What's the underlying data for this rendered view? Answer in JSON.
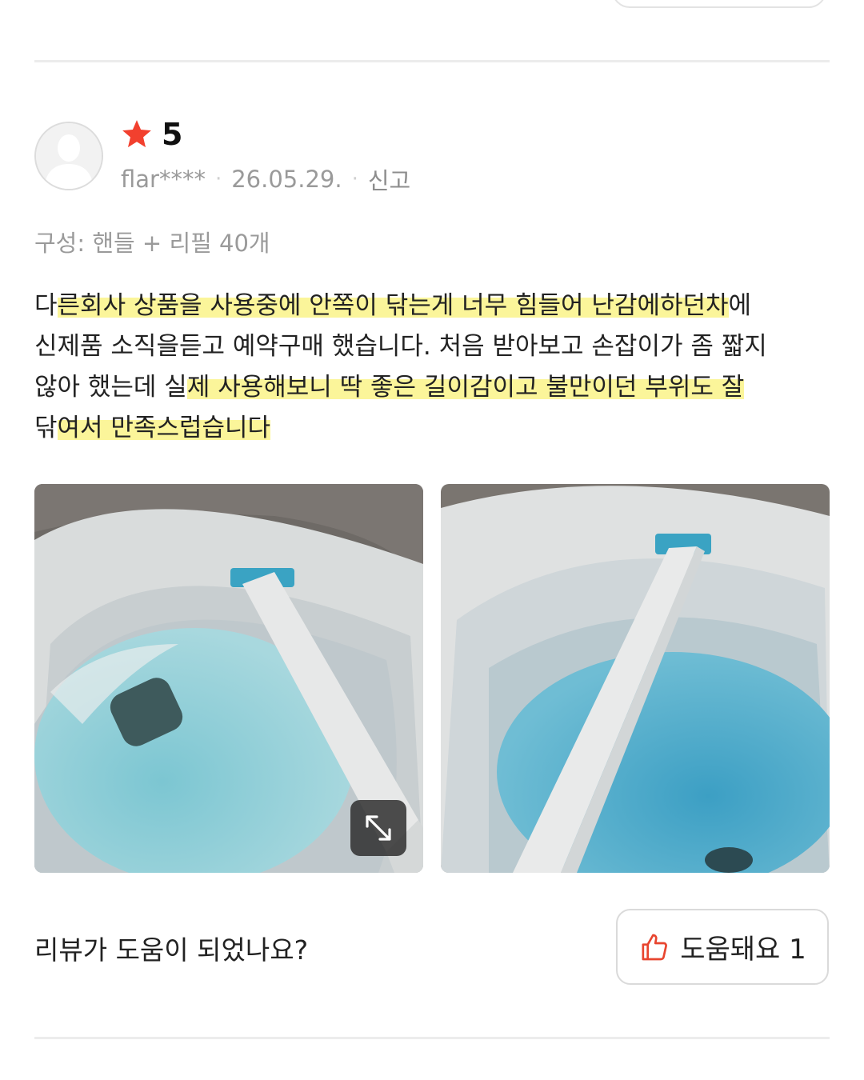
{
  "review": {
    "rating": "5",
    "username": "flar****",
    "date": "26.05.29.",
    "report_label": "신고",
    "option": "구성: 핸들 + 리필 40개",
    "body": {
      "l1a": "다",
      "l1b": "른회사 상품을 사용중에 안쪽이 닦는게 너무 힘들어 난감에하던차",
      "l1c": "에",
      "l2": "신제품 소직을듣고 예약구매 했습니다. 처음 받아보고 손잡이가 좀 짧지",
      "l3a": "않아 했는데 실",
      "l3b": "제 사용해보니 딱 좋은 길이감이고 불만이던 부위도 잘",
      "l4a": "닦",
      "l4b": "여서 만족스럽습니다"
    }
  },
  "helpful": {
    "question": "리뷰가 도움이 되었나요?",
    "button_label": "도움돼요 1"
  },
  "icons": {
    "star": "star-icon",
    "thumb": "thumbs-up-icon",
    "expand": "expand-icon",
    "avatar": "default-avatar-icon"
  },
  "colors": {
    "star": "#f2402e",
    "thumb": "#e8452f",
    "highlight": "#fbf59a"
  }
}
